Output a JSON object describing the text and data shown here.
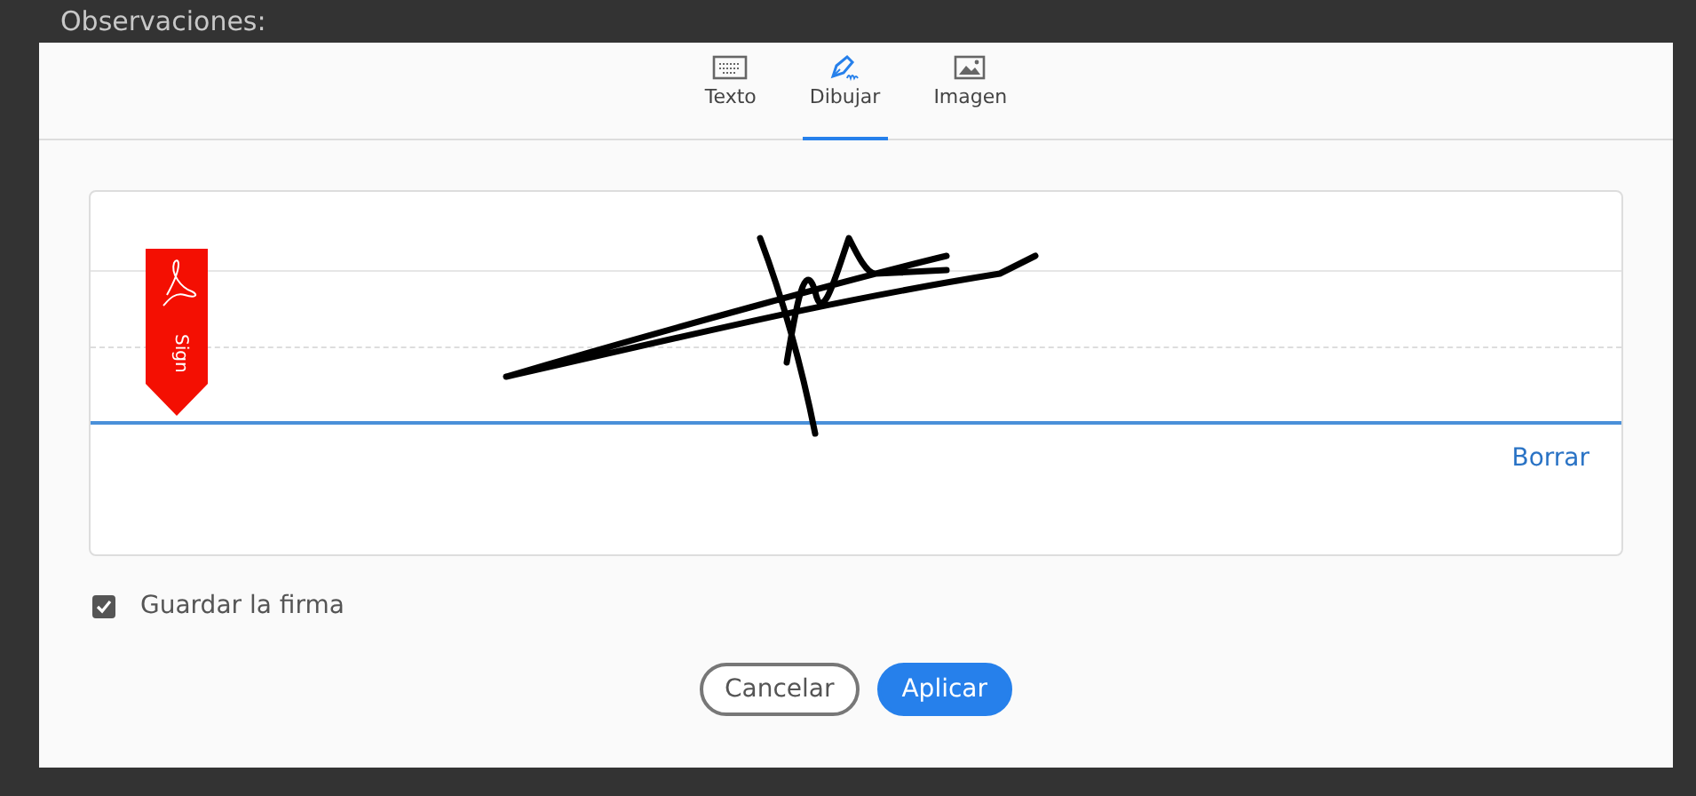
{
  "background": {
    "heading": "Observaciones:"
  },
  "tabs": [
    {
      "label": "Texto",
      "kind": "keyboard",
      "selected": false
    },
    {
      "label": "Dibujar",
      "kind": "pen",
      "selected": true
    },
    {
      "label": "Imagen",
      "kind": "image",
      "selected": false
    }
  ],
  "signature_pad": {
    "badge": "Sign",
    "clear": "Borrar"
  },
  "save_signature": {
    "label": "Guardar la firma",
    "checked": true
  },
  "buttons": [
    {
      "label": "Cancelar",
      "kind": "secondary"
    },
    {
      "label": "Aplicar",
      "kind": "primary"
    }
  ]
}
